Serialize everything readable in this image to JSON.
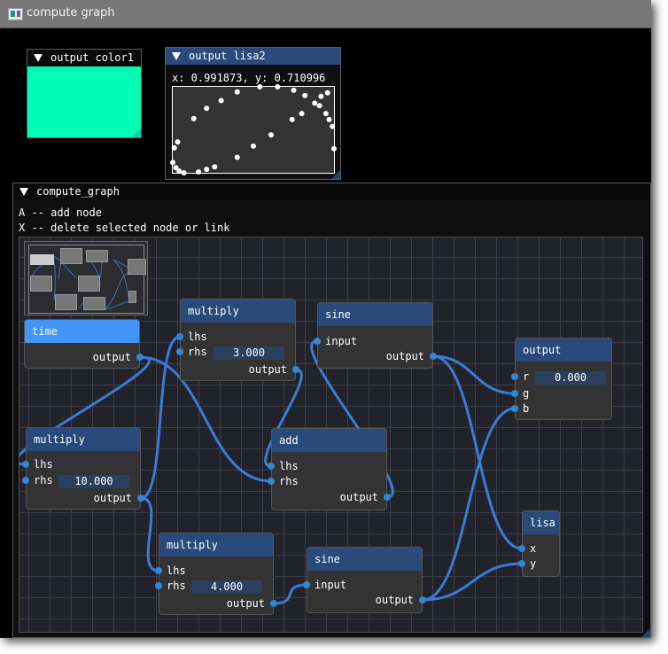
{
  "app": {
    "title": "compute graph",
    "icon": "app-window-icon"
  },
  "color_window": {
    "title": "output color1",
    "color": "#00fbb5"
  },
  "lisa_window": {
    "title": "output lisa2",
    "readout": "x: 0.991873, y: 0.710996",
    "points": [
      [
        0.4,
        0.06
      ],
      [
        0.54,
        0.0
      ],
      [
        0.65,
        0.0
      ],
      [
        0.75,
        0.04
      ],
      [
        0.82,
        0.1
      ],
      [
        0.88,
        0.19
      ],
      [
        0.91,
        0.22
      ],
      [
        0.92,
        0.11
      ],
      [
        0.96,
        0.07
      ],
      [
        0.95,
        0.31
      ],
      [
        0.97,
        0.38
      ],
      [
        0.99,
        0.46
      ],
      [
        1.0,
        0.72
      ],
      [
        0.8,
        0.31
      ],
      [
        0.74,
        0.38
      ],
      [
        0.61,
        0.56
      ],
      [
        0.5,
        0.69
      ],
      [
        0.4,
        0.82
      ],
      [
        0.26,
        0.93
      ],
      [
        0.21,
        0.96
      ],
      [
        0.16,
        0.99
      ],
      [
        0.07,
        1.0
      ],
      [
        0.04,
        0.98
      ],
      [
        0.02,
        0.94
      ],
      [
        0.0,
        0.88
      ],
      [
        0.01,
        0.71
      ],
      [
        0.03,
        0.64
      ],
      [
        0.13,
        0.37
      ],
      [
        0.21,
        0.25
      ],
      [
        0.3,
        0.16
      ]
    ]
  },
  "graph_window": {
    "title": "compute_graph",
    "help": [
      "A -- add node",
      "X -- delete selected node or link"
    ],
    "nodes": {
      "time": {
        "title": "time",
        "selected": true,
        "outputs": [
          "output"
        ]
      },
      "mul3": {
        "title": "multiply",
        "inputs": [
          "lhs",
          "rhs"
        ],
        "rhs_value": "3.000",
        "outputs": [
          "output"
        ]
      },
      "sine1": {
        "title": "sine",
        "inputs": [
          "input"
        ],
        "outputs": [
          "output"
        ]
      },
      "out": {
        "title": "output",
        "inputs": [
          "r",
          "g",
          "b"
        ],
        "r_value": "0.000"
      },
      "mul10": {
        "title": "multiply",
        "inputs": [
          "lhs",
          "rhs"
        ],
        "rhs_value": "10.000",
        "outputs": [
          "output"
        ]
      },
      "add": {
        "title": "add",
        "inputs": [
          "lhs",
          "rhs"
        ],
        "outputs": [
          "output"
        ]
      },
      "mul4": {
        "title": "multiply",
        "inputs": [
          "lhs",
          "rhs"
        ],
        "rhs_value": "4.000",
        "outputs": [
          "output"
        ]
      },
      "sine2": {
        "title": "sine",
        "inputs": [
          "input"
        ],
        "outputs": [
          "output"
        ]
      },
      "lisa": {
        "title": "lisa",
        "inputs": [
          "x",
          "y"
        ]
      }
    },
    "links": [
      {
        "from": "time.output",
        "to": "mul10.lhs"
      },
      {
        "from": "time.output",
        "to": "add.rhs"
      },
      {
        "from": "mul10.output",
        "to": "mul3.lhs"
      },
      {
        "from": "mul10.output",
        "to": "mul4.lhs"
      },
      {
        "from": "mul3.output",
        "to": "add.lhs"
      },
      {
        "from": "add.output",
        "to": "sine1.input"
      },
      {
        "from": "sine1.output",
        "to": "out.g"
      },
      {
        "from": "sine1.output",
        "to": "lisa.x"
      },
      {
        "from": "mul4.output",
        "to": "sine2.input"
      },
      {
        "from": "sine2.output",
        "to": "out.b"
      },
      {
        "from": "sine2.output",
        "to": "lisa.y"
      }
    ],
    "link_color": "#3a7bd5"
  }
}
